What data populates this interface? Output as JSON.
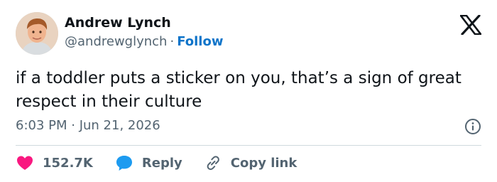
{
  "author": {
    "name": "Andrew Lynch",
    "handle": "@andrewglynch",
    "separator": "·",
    "follow_label": "Follow"
  },
  "post": {
    "text": "if a toddler puts a sticker on you, that’s a sign of great respect in their culture",
    "timestamp": "6:03 PM · Jun 21, 2026"
  },
  "actions": {
    "like_count": "152.7K",
    "reply_label": "Reply",
    "copy_link_label": "Copy link"
  },
  "icons": {
    "brand": "x-logo-icon",
    "info": "info-icon",
    "like": "heart-icon",
    "reply": "reply-bubble-icon",
    "copy": "link-icon"
  },
  "colors": {
    "text": "#0f1419",
    "secondary": "#536471",
    "follow": "#0f74c9",
    "like": "#f91880",
    "reply": "#1d9bf0",
    "divider": "#cfd9de"
  }
}
